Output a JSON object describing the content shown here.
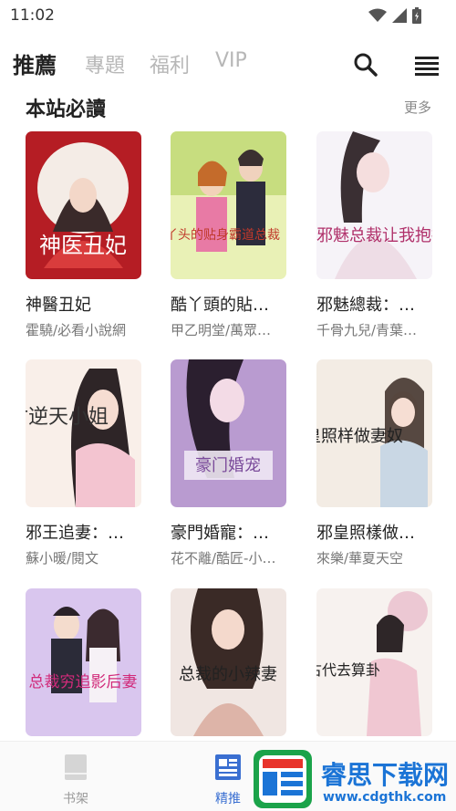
{
  "status_bar": {
    "time": "11:02"
  },
  "tabs": [
    {
      "label": "推薦",
      "active": true
    },
    {
      "label": "專題",
      "active": false
    },
    {
      "label": "福利",
      "active": false
    },
    {
      "label": "VIP",
      "active": false
    }
  ],
  "section": {
    "title": "本站必讀",
    "more": "更多"
  },
  "books": [
    {
      "title": "神醫丑妃",
      "meta": "霍驍/必看小說網",
      "cover_text": "神医丑妃"
    },
    {
      "title": "酷丫頭的貼…",
      "meta": "甲乙明堂/萬眾…",
      "cover_text": "酷丫头的贴身霸道总裁"
    },
    {
      "title": "邪魅總裁：…",
      "meta": "千骨九兒/青葉…",
      "cover_text": "邪魅总裁让我抱抱"
    },
    {
      "title": "邪王追妻：…",
      "meta": "蘇小暖/閱文",
      "cover_text": "废材逆天小姐"
    },
    {
      "title": "豪門婚寵：…",
      "meta": "花不離/酷匠-小…",
      "cover_text": "豪门婚宠"
    },
    {
      "title": "邪皇照樣做…",
      "meta": "來樂/華夏天空",
      "cover_text": "邪皇照样做妻奴"
    },
    {
      "title": "",
      "meta": "",
      "cover_text": "总裁穷追影后妻"
    },
    {
      "title": "",
      "meta": "",
      "cover_text": "总裁的小辣妻"
    },
    {
      "title": "",
      "meta": "",
      "cover_text": "古代去算卦"
    }
  ],
  "bottom_nav": [
    {
      "label": "书架",
      "active": false
    },
    {
      "label": "精推",
      "active": true
    }
  ],
  "watermark": {
    "text": "睿思下载网",
    "url": "www.cdgthk.com"
  },
  "colors": {
    "accent": "#3a6fd1",
    "tab_inactive": "#b7b7b7",
    "watermark": "#1b74d6"
  },
  "icons": [
    "wifi-icon",
    "signal-icon",
    "battery-icon",
    "search-icon",
    "menu-icon",
    "bookshelf-icon",
    "featured-icon"
  ]
}
